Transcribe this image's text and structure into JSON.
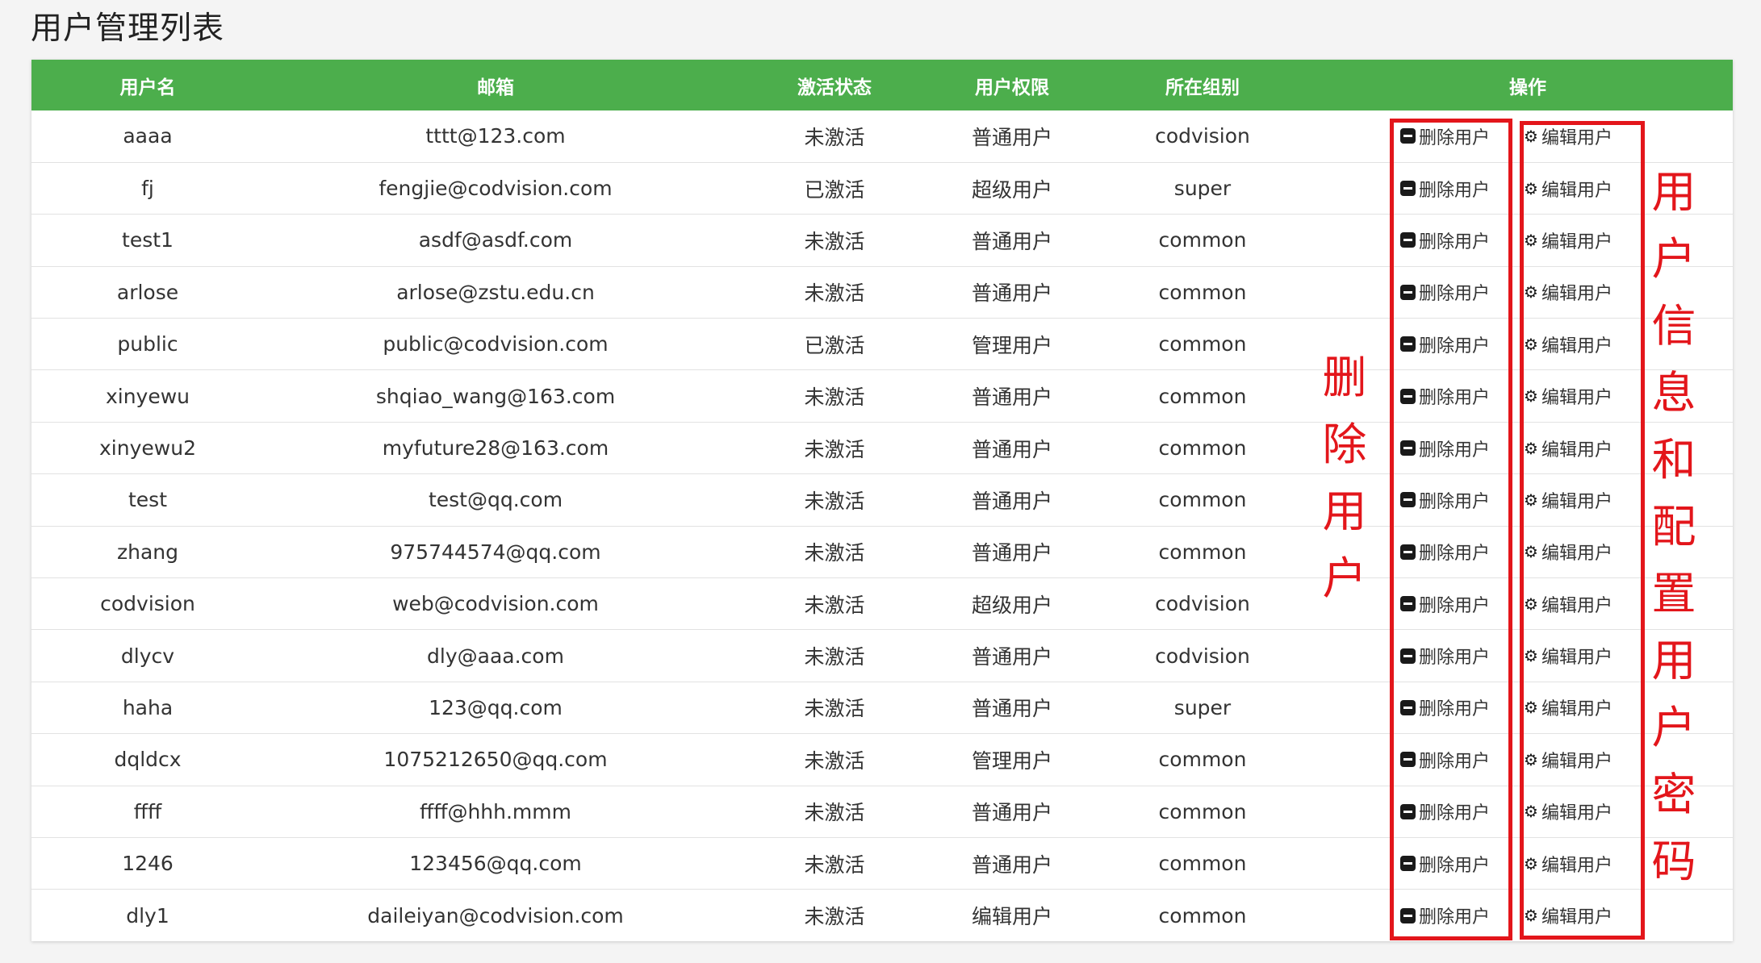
{
  "page_title": "用户管理列表",
  "table": {
    "headers": {
      "username": "用户名",
      "email": "邮箱",
      "status": "激活状态",
      "role": "用户权限",
      "group": "所在组别",
      "actions": "操作"
    },
    "delete_label": "删除用户",
    "edit_label": "编辑用户",
    "rows": [
      {
        "username": "aaaa",
        "email": "tttt@123.com",
        "status": "未激活",
        "role": "普通用户",
        "group": "codvision"
      },
      {
        "username": "fj",
        "email": "fengjie@codvision.com",
        "status": "已激活",
        "role": "超级用户",
        "group": "super"
      },
      {
        "username": "test1",
        "email": "asdf@asdf.com",
        "status": "未激活",
        "role": "普通用户",
        "group": "common"
      },
      {
        "username": "arlose",
        "email": "arlose@zstu.edu.cn",
        "status": "未激活",
        "role": "普通用户",
        "group": "common"
      },
      {
        "username": "public",
        "email": "public@codvision.com",
        "status": "已激活",
        "role": "管理用户",
        "group": "common"
      },
      {
        "username": "xinyewu",
        "email": "shqiao_wang@163.com",
        "status": "未激活",
        "role": "普通用户",
        "group": "common"
      },
      {
        "username": "xinyewu2",
        "email": "myfuture28@163.com",
        "status": "未激活",
        "role": "普通用户",
        "group": "common"
      },
      {
        "username": "test",
        "email": "test@qq.com",
        "status": "未激活",
        "role": "普通用户",
        "group": "common"
      },
      {
        "username": "zhang",
        "email": "975744574@qq.com",
        "status": "未激活",
        "role": "普通用户",
        "group": "common"
      },
      {
        "username": "codvision",
        "email": "web@codvision.com",
        "status": "未激活",
        "role": "超级用户",
        "group": "codvision"
      },
      {
        "username": "dlycv",
        "email": "dly@aaa.com",
        "status": "未激活",
        "role": "普通用户",
        "group": "codvision"
      },
      {
        "username": "haha",
        "email": "123@qq.com",
        "status": "未激活",
        "role": "普通用户",
        "group": "super"
      },
      {
        "username": "dqldcx",
        "email": "1075212650@qq.com",
        "status": "未激活",
        "role": "管理用户",
        "group": "common"
      },
      {
        "username": "ffff",
        "email": "ffff@hhh.mmm",
        "status": "未激活",
        "role": "普通用户",
        "group": "common"
      },
      {
        "username": "1246",
        "email": "123456@qq.com",
        "status": "未激活",
        "role": "普通用户",
        "group": "common"
      },
      {
        "username": "dly1",
        "email": "daileiyan@codvision.com",
        "status": "未激活",
        "role": "编辑用户",
        "group": "common"
      }
    ]
  },
  "annotations": {
    "delete_note": "删除用户",
    "edit_note": "用户信息和配置用户密码",
    "color": "#e3161b"
  },
  "colors": {
    "header_bg": "#4cae4c",
    "header_text": "#ffffff"
  }
}
